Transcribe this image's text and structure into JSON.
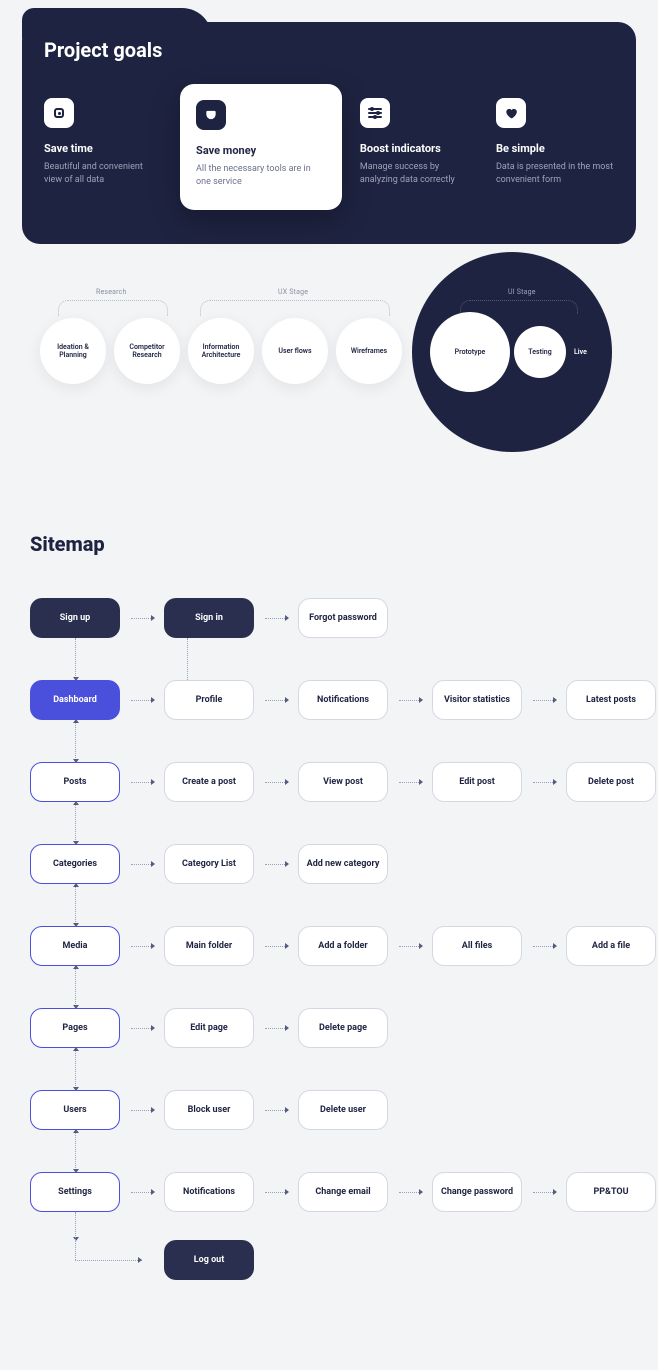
{
  "goals": {
    "title": "Project goals",
    "items": [
      {
        "name": "save-time",
        "title": "Save time",
        "desc": "Beautiful and convenient view of all data"
      },
      {
        "name": "save-money",
        "title": "Save money",
        "desc": "All the necessary tools are in one service"
      },
      {
        "name": "boost",
        "title": "Boost indicators",
        "desc": "Manage success by analyzing data correctly"
      },
      {
        "name": "simple",
        "title": "Be simple",
        "desc": "Data is presented in the most convenient form"
      }
    ]
  },
  "stages": {
    "research_label": "Research",
    "ux_label": "UX Stage",
    "ui_label": "UI Stage",
    "bubbles": [
      "Ideation & Planning",
      "Competitor Research",
      "Information Architecture",
      "User flows",
      "Wireframes",
      "Prototype",
      "Testing"
    ],
    "live": "Live"
  },
  "sitemap": {
    "title": "Sitemap",
    "rows": [
      {
        "primary": "Sign up",
        "primaryStyle": "dark",
        "children": [
          [
            "Sign in",
            "dark"
          ],
          [
            "Forgot password",
            "outline-gray"
          ]
        ]
      },
      {
        "primary": "Dashboard",
        "primaryStyle": "blue",
        "children": [
          [
            "Profile",
            "outline-gray"
          ],
          [
            "Notifications",
            "outline-gray"
          ],
          [
            "Visitor statistics",
            "outline-gray"
          ],
          [
            "Latest posts",
            "outline-gray"
          ]
        ]
      },
      {
        "primary": "Posts",
        "primaryStyle": "outline-blue",
        "children": [
          [
            "Create a post",
            "outline-gray"
          ],
          [
            "View post",
            "outline-gray"
          ],
          [
            "Edit post",
            "outline-gray"
          ],
          [
            "Delete post",
            "outline-gray"
          ]
        ]
      },
      {
        "primary": "Categories",
        "primaryStyle": "outline-blue",
        "children": [
          [
            "Category List",
            "outline-gray"
          ],
          [
            "Add new category",
            "outline-gray"
          ]
        ]
      },
      {
        "primary": "Media",
        "primaryStyle": "outline-blue",
        "children": [
          [
            "Main folder",
            "outline-gray"
          ],
          [
            "Add a folder",
            "outline-gray"
          ],
          [
            "All files",
            "outline-gray"
          ],
          [
            "Add a file",
            "outline-gray"
          ]
        ]
      },
      {
        "primary": "Pages",
        "primaryStyle": "outline-blue",
        "children": [
          [
            "Edit page",
            "outline-gray"
          ],
          [
            "Delete page",
            "outline-gray"
          ]
        ]
      },
      {
        "primary": "Users",
        "primaryStyle": "outline-blue",
        "children": [
          [
            "Block user",
            "outline-gray"
          ],
          [
            "Delete user",
            "outline-gray"
          ]
        ]
      },
      {
        "primary": "Settings",
        "primaryStyle": "outline-blue",
        "children": [
          [
            "Notifications",
            "outline-gray"
          ],
          [
            "Change email",
            "outline-gray"
          ],
          [
            "Change password",
            "outline-gray"
          ],
          [
            "PP&TOU",
            "outline-gray"
          ]
        ]
      }
    ],
    "logout": "Log out"
  }
}
